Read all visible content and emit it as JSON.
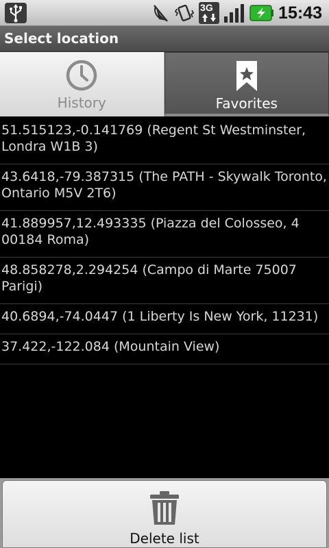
{
  "status_bar": {
    "time": "15:43",
    "network_type": "3G",
    "icons": [
      "usb-icon",
      "muted-icon",
      "vibrate-icon",
      "3g-data-icon",
      "signal-icon",
      "battery-charging-icon"
    ],
    "battery_color": "#2fb72f"
  },
  "header": {
    "title": "Select location"
  },
  "tabs": [
    {
      "label": "History",
      "icon": "clock-icon",
      "selected": false
    },
    {
      "label": "Favorites",
      "icon": "bookmark-star-icon",
      "selected": true
    }
  ],
  "locations": [
    {
      "text": "51.515123,-0.141769 (Regent St Westminster, Londra W1B 3)"
    },
    {
      "text": "43.6418,-79.387315 (The PATH - Skywalk Toronto, Ontario M5V 2T6)"
    },
    {
      "text": "41.889957,12.493335 (Piazza del Colosseo, 4 00184 Roma)"
    },
    {
      "text": "48.858278,2.294254 (Campo di Marte 75007 Parigi)"
    },
    {
      "text": "40.6894,-74.0447 (1 Liberty Is New York, 11231)"
    },
    {
      "text": "37.422,-122.084 (Mountain View)"
    }
  ],
  "footer": {
    "delete_label": "Delete list",
    "icon": "trash-icon"
  }
}
